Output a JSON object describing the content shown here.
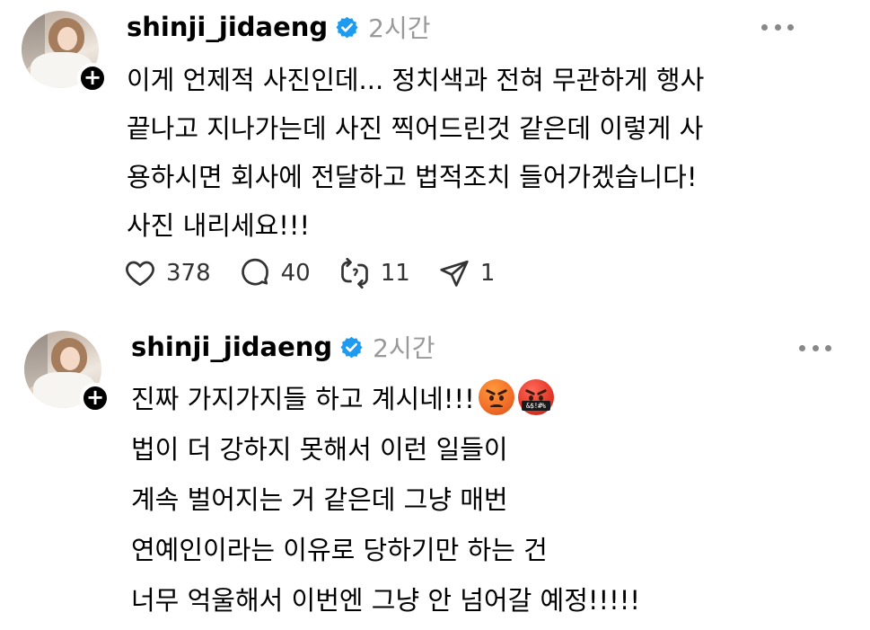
{
  "posts": [
    {
      "username": "shinji_jidaeng",
      "timestamp": "2시간",
      "lines": [
        "이게 언제적 사진인데... 정치색과 전혀 무관하게 행사",
        "끝나고 지나가는데 사진 찍어드린것 같은데 이렇게 사",
        "용하시면 회사에 전달하고 법적조치 들어가겠습니다!",
        "사진 내리세요!!!"
      ],
      "actions": {
        "likes": "378",
        "comments": "40",
        "reposts": "11",
        "shares": "1"
      }
    },
    {
      "username": "shinji_jidaeng",
      "timestamp": "2시간",
      "lines": [
        "진짜 가지가지들 하고 계시네!!!",
        "법이 더 강하지 못해서 이런 일들이",
        "계속 벌어지는 거 같은데 그냥 매번",
        "연예인이라는 이유로 당하기만 하는 건",
        "너무 억울해서 이번엔 그냥 안 넘어갈 예정!!!!!"
      ],
      "emojis": [
        "angry-face",
        "face-with-symbols-on-mouth"
      ],
      "emoji_symbols": "&$!#%"
    }
  ],
  "icons": {
    "verified": "verified-badge-icon",
    "more": "more-options-icon",
    "like": "heart-icon",
    "comment": "comment-icon",
    "repost": "repost-icon",
    "share": "share-icon",
    "follow": "plus-icon"
  },
  "colors": {
    "verified_badge": "#1d9bf0",
    "timestamp": "#999999",
    "text": "#000000"
  }
}
